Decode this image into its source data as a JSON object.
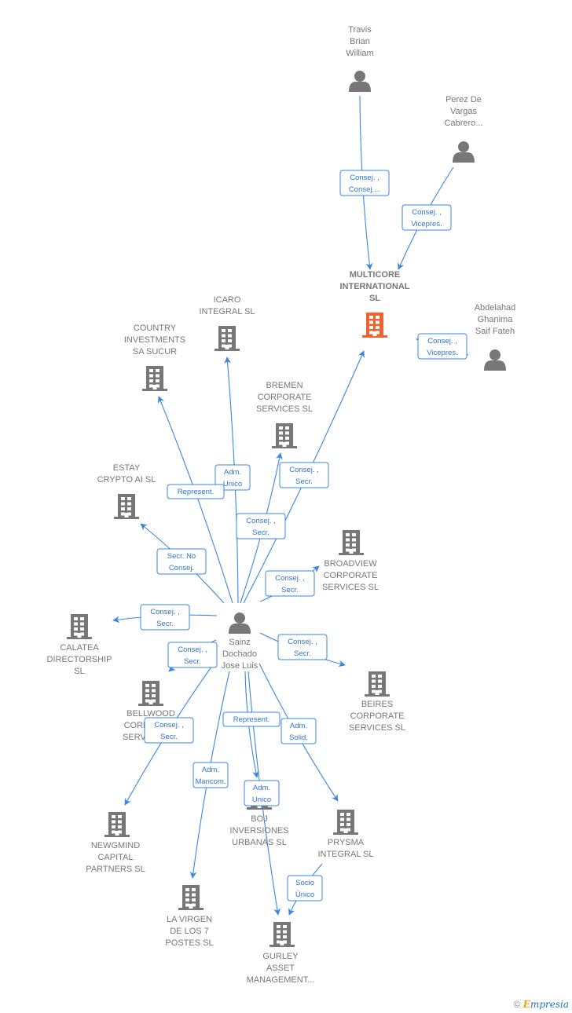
{
  "colors": {
    "edge": "#3a86e0",
    "node": "#777777",
    "highlight": "#f0622f"
  },
  "nodes": [
    {
      "id": "travis",
      "type": "person",
      "label": [
        "Travis",
        "Brian",
        "William"
      ]
    },
    {
      "id": "perez",
      "type": "person",
      "label": [
        "Perez De",
        "Vargas",
        "Cabrero..."
      ]
    },
    {
      "id": "multicore",
      "type": "company",
      "highlight": true,
      "label": [
        "MULTICORE",
        "INTERNATIONAL",
        "SL"
      ]
    },
    {
      "id": "abdelahad",
      "type": "person",
      "label": [
        "Abdelahad",
        "Ghanima",
        "Saif Fateh"
      ]
    },
    {
      "id": "icaro",
      "type": "company",
      "label": [
        "ICARO",
        "INTEGRAL SL"
      ]
    },
    {
      "id": "country",
      "type": "company",
      "label": [
        "COUNTRY",
        "INVESTMENTS",
        "SA SUCUR"
      ]
    },
    {
      "id": "bremen",
      "type": "company",
      "label": [
        "BREMEN",
        "CORPORATE",
        "SERVICES SL"
      ]
    },
    {
      "id": "estay",
      "type": "company",
      "label": [
        "ESTAY",
        "CRYPTO AI  SL"
      ]
    },
    {
      "id": "broadview",
      "type": "company",
      "label": [
        "BROADVIEW",
        "CORPORATE",
        "SERVICES  SL"
      ]
    },
    {
      "id": "calatea",
      "type": "company",
      "label": [
        "CALATEA",
        "DIRECTORSHIP",
        "SL"
      ]
    },
    {
      "id": "sainz",
      "type": "person",
      "label": [
        "Sainz",
        "Dochado",
        "Jose Luis"
      ]
    },
    {
      "id": "beires",
      "type": "company",
      "label": [
        "BEIRES",
        "CORPORATE",
        "SERVICES  SL"
      ]
    },
    {
      "id": "bellwood",
      "type": "company",
      "label": [
        "BELLWOOD",
        "CORPORATE",
        "SERVICES SL"
      ]
    },
    {
      "id": "newgmind",
      "type": "company",
      "label": [
        "NEWGMIND",
        "CAPITAL",
        "PARTNERS SL"
      ]
    },
    {
      "id": "boj",
      "type": "company",
      "label": [
        "BOJ",
        "INVERSIONES",
        "URBANAS SL"
      ]
    },
    {
      "id": "prysma",
      "type": "company",
      "label": [
        "PRYSMA",
        "INTEGRAL SL"
      ]
    },
    {
      "id": "lavirgen",
      "type": "company",
      "label": [
        "LA VIRGEN",
        "DE LOS 7",
        "POSTES  SL"
      ]
    },
    {
      "id": "gurley",
      "type": "company",
      "label": [
        "GURLEY",
        "ASSET",
        "MANAGEMENT..."
      ]
    }
  ],
  "edges": [
    {
      "from": "travis",
      "to": "multicore",
      "label": [
        "Consej. ,",
        "Consej...."
      ]
    },
    {
      "from": "perez",
      "to": "multicore",
      "label": [
        "Consej. ,",
        "Vicepres."
      ]
    },
    {
      "from": "abdelahad",
      "to": "multicore",
      "label": [
        "Consej. ,",
        "Vicepres."
      ]
    },
    {
      "from": "sainz",
      "to": "multicore",
      "label": [
        "Consej. ,",
        "Secr."
      ]
    },
    {
      "from": "sainz",
      "to": "icaro",
      "label": [
        "Adm.",
        "Unico"
      ]
    },
    {
      "from": "sainz",
      "to": "country",
      "label": [
        "Represent."
      ]
    },
    {
      "from": "sainz",
      "to": "bremen",
      "label": [
        "Consej. ,",
        "Secr."
      ]
    },
    {
      "from": "sainz",
      "to": "estay",
      "label": [
        "Secr.  No",
        "Consej."
      ]
    },
    {
      "from": "sainz",
      "to": "broadview",
      "label": [
        "Consej. ,",
        "Secr."
      ]
    },
    {
      "from": "sainz",
      "to": "calatea",
      "label": [
        "Consej. ,",
        "Secr."
      ]
    },
    {
      "from": "sainz",
      "to": "beires",
      "label": [
        "Consej. ,",
        "Secr."
      ]
    },
    {
      "from": "sainz",
      "to": "bellwood",
      "label": [
        "Consej. ,",
        "Secr."
      ]
    },
    {
      "from": "sainz",
      "to": "newgmind",
      "label": [
        "Consej. ,",
        "Secr."
      ]
    },
    {
      "from": "sainz",
      "to": "boj",
      "label": [
        "Represent."
      ]
    },
    {
      "from": "sainz",
      "to": "prysma",
      "label": [
        "Adm.",
        "Solid."
      ]
    },
    {
      "from": "sainz",
      "to": "lavirgen",
      "label": [
        "Adm.",
        "Mancom."
      ]
    },
    {
      "from": "sainz",
      "to": "gurley",
      "label": [
        "Adm.",
        "Unico"
      ]
    },
    {
      "from": "prysma",
      "to": "gurley",
      "label": [
        "Socio",
        "Único"
      ]
    }
  ],
  "footer": {
    "copyright": "©",
    "brand_initial": "E",
    "brand_rest": "mpresia"
  }
}
